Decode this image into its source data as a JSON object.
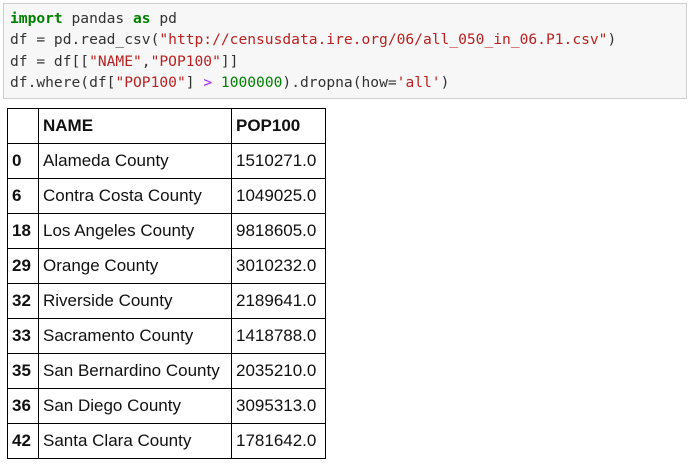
{
  "code_cell": {
    "line1": {
      "kw1": "import",
      "mid": " pandas ",
      "kw2": "as",
      "tail": " pd"
    },
    "line2": {
      "pre": "df = pd.read_csv(",
      "str": "\"http://censusdata.ire.org/06/all_050_in_06.P1.csv\"",
      "post": ")"
    },
    "line3": {
      "pre": "df = df[[",
      "s1": "\"NAME\"",
      "comma": ",",
      "s2": "\"POP100\"",
      "post": "]]"
    },
    "line4": {
      "pre": "df.where(df[",
      "s1": "\"POP100\"",
      "mid": "] ",
      "op": ">",
      "sp": " ",
      "num": "1000000",
      "mid2": ").dropna(how=",
      "s2": "'all'",
      "post": ")"
    }
  },
  "table": {
    "index_header": "",
    "columns": [
      "NAME",
      "POP100"
    ],
    "rows": [
      {
        "index": "0",
        "name": "Alameda County",
        "pop": "1510271.0"
      },
      {
        "index": "6",
        "name": "Contra Costa County",
        "pop": "1049025.0"
      },
      {
        "index": "18",
        "name": "Los Angeles County",
        "pop": "9818605.0"
      },
      {
        "index": "29",
        "name": "Orange County",
        "pop": "3010232.0"
      },
      {
        "index": "32",
        "name": "Riverside County",
        "pop": "2189641.0"
      },
      {
        "index": "33",
        "name": "Sacramento County",
        "pop": "1418788.0"
      },
      {
        "index": "35",
        "name": "San Bernardino County",
        "pop": "2035210.0"
      },
      {
        "index": "36",
        "name": "San Diego County",
        "pop": "3095313.0"
      },
      {
        "index": "42",
        "name": "Santa Clara County",
        "pop": "1781642.0"
      }
    ]
  },
  "colors": {
    "keyword": "#008000",
    "string": "#ba2121",
    "number": "#008000",
    "operator": "#aa22ff",
    "cell_background": "#f7f7f7",
    "cell_border": "#cfcfcf"
  }
}
